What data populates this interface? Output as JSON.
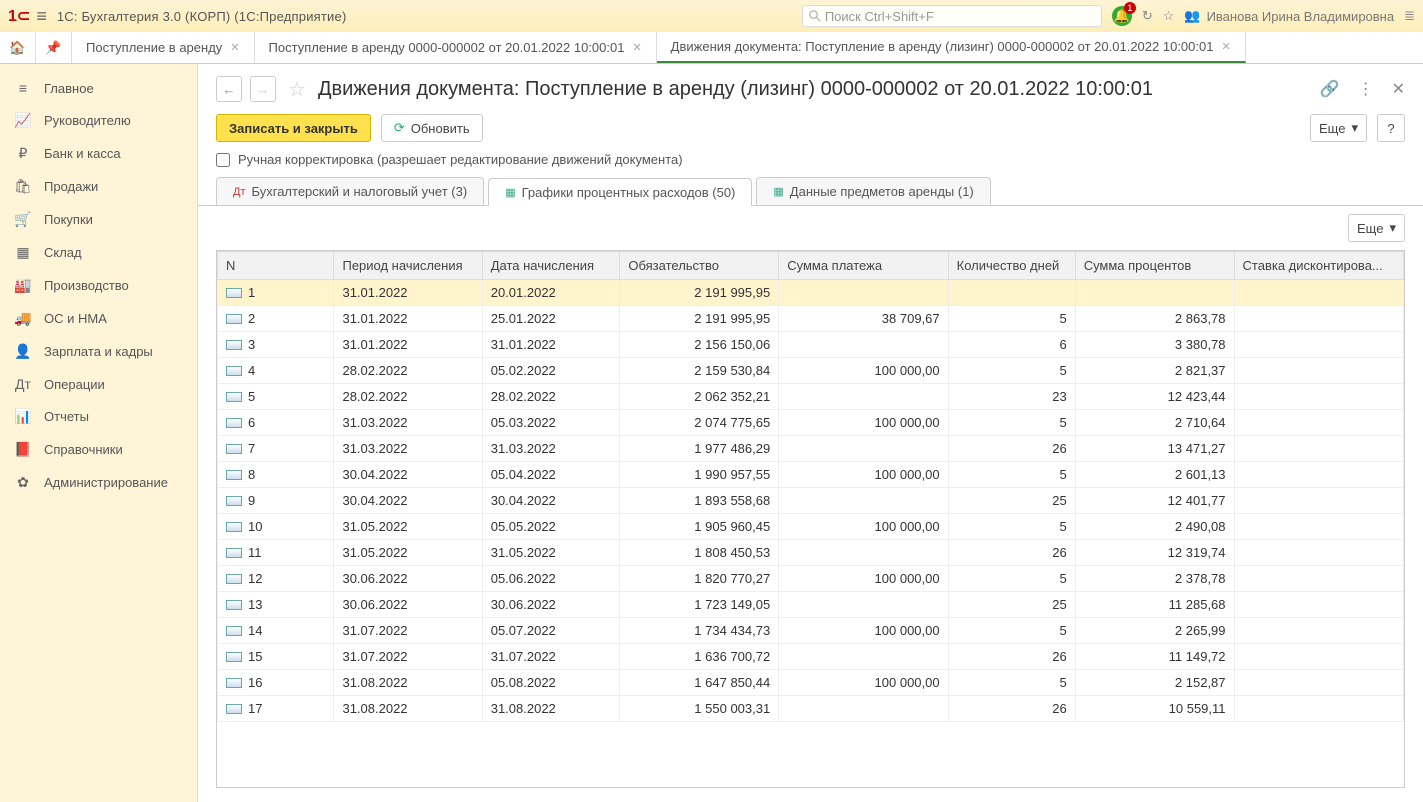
{
  "app_title": "1С: Бухгалтерия 3.0 (КОРП)  (1С:Предприятие)",
  "search_placeholder": "Поиск Ctrl+Shift+F",
  "bell_badge": "1",
  "username": "Иванова Ирина Владимировна",
  "nav_tabs": [
    {
      "label": "Поступление в аренду"
    },
    {
      "label": "Поступление в аренду 0000-000002 от 20.01.2022 10:00:01"
    },
    {
      "label": "Движения документа: Поступление в аренду (лизинг) 0000-000002 от 20.01.2022 10:00:01",
      "active": true
    }
  ],
  "sidebar": {
    "items": [
      {
        "icon": "≡",
        "label": "Главное"
      },
      {
        "icon": "📈",
        "label": "Руководителю"
      },
      {
        "icon": "₽",
        "label": "Банк и касса"
      },
      {
        "icon": "🛍",
        "label": "Продажи"
      },
      {
        "icon": "🛒",
        "label": "Покупки"
      },
      {
        "icon": "▦",
        "label": "Склад"
      },
      {
        "icon": "🏭",
        "label": "Производство"
      },
      {
        "icon": "🚚",
        "label": "ОС и НМА"
      },
      {
        "icon": "👤",
        "label": "Зарплата и кадры"
      },
      {
        "icon": "Дт",
        "label": "Операции"
      },
      {
        "icon": "📊",
        "label": "Отчеты"
      },
      {
        "icon": "📕",
        "label": "Справочники"
      },
      {
        "icon": "✿",
        "label": "Администрирование"
      }
    ]
  },
  "page_title": "Движения документа: Поступление в аренду (лизинг) 0000-000002 от 20.01.2022 10:00:01",
  "toolbar": {
    "save_close": "Записать и закрыть",
    "refresh": "Обновить",
    "more": "Еще",
    "help": "?"
  },
  "manual_edit_label": "Ручная корректировка (разрешает редактирование движений документа)",
  "inner_tabs": [
    {
      "label": "Бухгалтерский и налоговый учет (3)"
    },
    {
      "label": "Графики процентных расходов (50)",
      "active": true
    },
    {
      "label": "Данные предметов аренды (1)"
    }
  ],
  "table_more": "Еще",
  "columns": {
    "n": "N",
    "period": "Период начисления",
    "date": "Дата начисления",
    "liability": "Обязательство",
    "payment": "Сумма платежа",
    "days": "Количество дней",
    "interest": "Сумма процентов",
    "rate": "Ставка дисконтирова..."
  },
  "rows": [
    {
      "n": "1",
      "period": "31.01.2022",
      "date": "20.01.2022",
      "liab": "2 191 995,95",
      "pay": "",
      "days": "",
      "int": "",
      "rate": ""
    },
    {
      "n": "2",
      "period": "31.01.2022",
      "date": "25.01.2022",
      "liab": "2 191 995,95",
      "pay": "38 709,67",
      "days": "5",
      "int": "2 863,78",
      "rate": ""
    },
    {
      "n": "3",
      "period": "31.01.2022",
      "date": "31.01.2022",
      "liab": "2 156 150,06",
      "pay": "",
      "days": "6",
      "int": "3 380,78",
      "rate": ""
    },
    {
      "n": "4",
      "period": "28.02.2022",
      "date": "05.02.2022",
      "liab": "2 159 530,84",
      "pay": "100 000,00",
      "days": "5",
      "int": "2 821,37",
      "rate": ""
    },
    {
      "n": "5",
      "period": "28.02.2022",
      "date": "28.02.2022",
      "liab": "2 062 352,21",
      "pay": "",
      "days": "23",
      "int": "12 423,44",
      "rate": ""
    },
    {
      "n": "6",
      "period": "31.03.2022",
      "date": "05.03.2022",
      "liab": "2 074 775,65",
      "pay": "100 000,00",
      "days": "5",
      "int": "2 710,64",
      "rate": ""
    },
    {
      "n": "7",
      "period": "31.03.2022",
      "date": "31.03.2022",
      "liab": "1 977 486,29",
      "pay": "",
      "days": "26",
      "int": "13 471,27",
      "rate": ""
    },
    {
      "n": "8",
      "period": "30.04.2022",
      "date": "05.04.2022",
      "liab": "1 990 957,55",
      "pay": "100 000,00",
      "days": "5",
      "int": "2 601,13",
      "rate": ""
    },
    {
      "n": "9",
      "period": "30.04.2022",
      "date": "30.04.2022",
      "liab": "1 893 558,68",
      "pay": "",
      "days": "25",
      "int": "12 401,77",
      "rate": ""
    },
    {
      "n": "10",
      "period": "31.05.2022",
      "date": "05.05.2022",
      "liab": "1 905 960,45",
      "pay": "100 000,00",
      "days": "5",
      "int": "2 490,08",
      "rate": ""
    },
    {
      "n": "11",
      "period": "31.05.2022",
      "date": "31.05.2022",
      "liab": "1 808 450,53",
      "pay": "",
      "days": "26",
      "int": "12 319,74",
      "rate": ""
    },
    {
      "n": "12",
      "period": "30.06.2022",
      "date": "05.06.2022",
      "liab": "1 820 770,27",
      "pay": "100 000,00",
      "days": "5",
      "int": "2 378,78",
      "rate": ""
    },
    {
      "n": "13",
      "period": "30.06.2022",
      "date": "30.06.2022",
      "liab": "1 723 149,05",
      "pay": "",
      "days": "25",
      "int": "11 285,68",
      "rate": ""
    },
    {
      "n": "14",
      "period": "31.07.2022",
      "date": "05.07.2022",
      "liab": "1 734 434,73",
      "pay": "100 000,00",
      "days": "5",
      "int": "2 265,99",
      "rate": ""
    },
    {
      "n": "15",
      "period": "31.07.2022",
      "date": "31.07.2022",
      "liab": "1 636 700,72",
      "pay": "",
      "days": "26",
      "int": "11 149,72",
      "rate": ""
    },
    {
      "n": "16",
      "period": "31.08.2022",
      "date": "05.08.2022",
      "liab": "1 647 850,44",
      "pay": "100 000,00",
      "days": "5",
      "int": "2 152,87",
      "rate": ""
    },
    {
      "n": "17",
      "period": "31.08.2022",
      "date": "31.08.2022",
      "liab": "1 550 003,31",
      "pay": "",
      "days": "26",
      "int": "10 559,11",
      "rate": ""
    }
  ]
}
